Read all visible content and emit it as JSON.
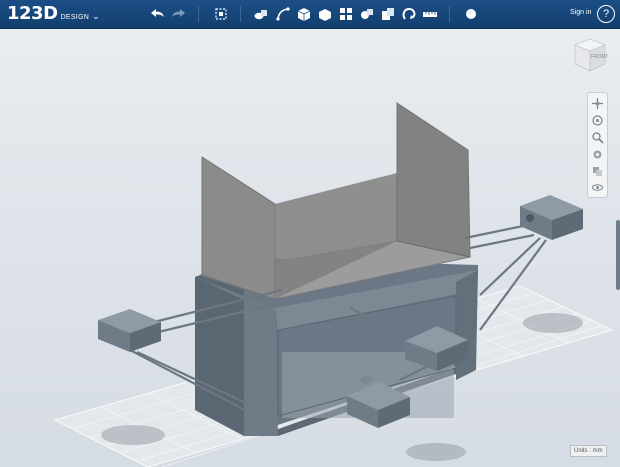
{
  "app": {
    "logo_main": "123D",
    "logo_sub": "DESIGN",
    "logo_chevron": "⌄"
  },
  "toolbar": {
    "icons": [
      "undo-icon",
      "redo-icon",
      "transform-icon",
      "primitives-icon",
      "sketch-icon",
      "construct-icon",
      "modify-icon",
      "pattern-icon",
      "grouping-icon",
      "combine-icon",
      "snap-icon",
      "measure-icon",
      "material-icon"
    ]
  },
  "account": {
    "sign_in": "Sign in",
    "help": "?"
  },
  "viewcube": {
    "face_label": "FRONT"
  },
  "navigation": {
    "buttons": [
      "pan-icon",
      "orbit-icon",
      "zoom-icon",
      "fit-icon",
      "view-mode-icon",
      "visibility-icon"
    ]
  },
  "status": {
    "units_label": "Units : mm"
  },
  "colors": {
    "toolbar_bg": "#1b4f86",
    "viewport_bg": "#dfe4ea",
    "model_gray": "#6f7c88",
    "panel_gray": "#8a8a8a"
  }
}
